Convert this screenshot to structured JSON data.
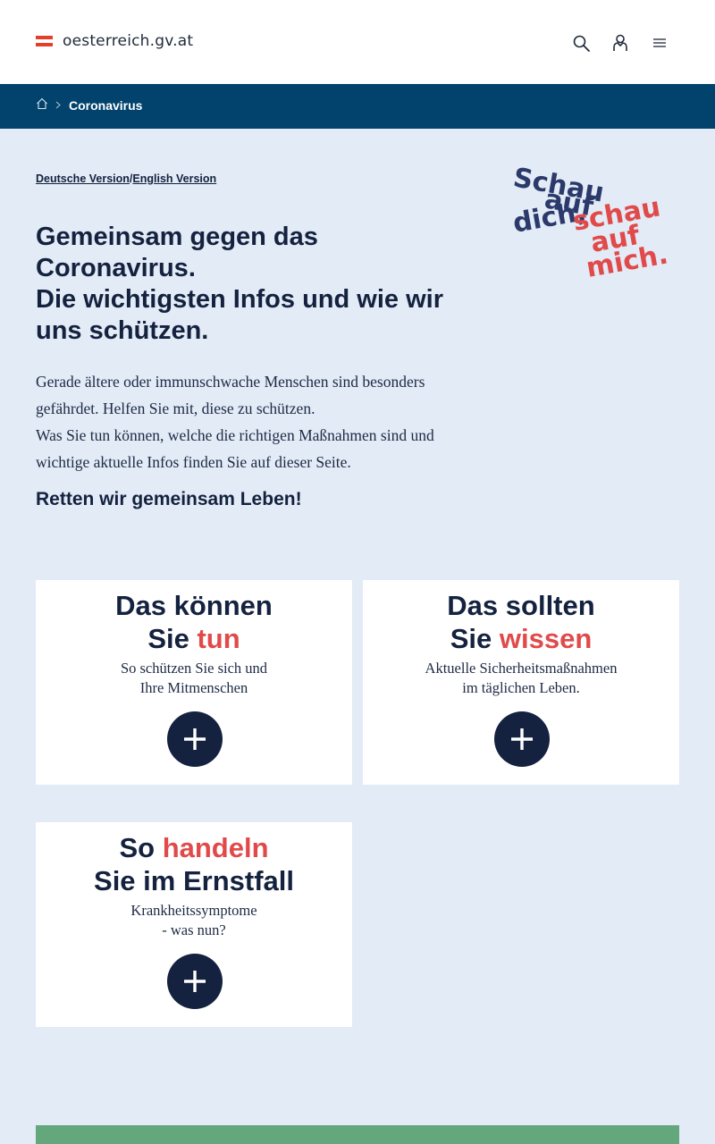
{
  "header": {
    "site_name": "oesterreich.gv.at",
    "icons": [
      "search-icon",
      "user-icon",
      "menu-icon"
    ],
    "flag_colors": [
      "#e3402b",
      "#ffffff",
      "#e3402b"
    ]
  },
  "breadcrumb": {
    "home_icon": "home-icon",
    "current": "Coronavirus"
  },
  "language": {
    "german": "Deutsche Version",
    "separator": "/",
    "english": "English Version"
  },
  "slogan": {
    "line1": "Schau",
    "line2": "auf",
    "line3": "dich,",
    "line4": "schau",
    "line5": "auf",
    "line6": "mich."
  },
  "hero": {
    "title_lines": [
      "Gemeinsam gegen das",
      "Coronavirus.",
      "Die wichtigsten Infos und wie wir",
      "uns schützen."
    ],
    "intro_1": "Gerade ältere oder immunschwache Menschen sind besonders gefährdet. Helfen Sie mit, diese zu schützen.",
    "intro_2": "Was Sie tun können, welche die richtigen Maßnahmen sind und wichtige aktuelle Infos finden Sie auf dieser Seite.",
    "cta": "Retten wir gemeinsam Leben!"
  },
  "cards": [
    {
      "line1": "Das können",
      "line2_pre": "Sie ",
      "line2_hl": "tun",
      "desc1": "So schützen Sie sich und",
      "desc2": "Ihre Mitmenschen"
    },
    {
      "line1": "Das sollten",
      "line2_pre": "Sie ",
      "line2_hl": "wissen",
      "desc1": "Aktuelle Sicherheitsmaßnahmen",
      "desc2": "im täglichen Leben."
    },
    {
      "line1_pre": "So ",
      "line1_hl": "handeln",
      "line2": "Sie im Ernstfall",
      "desc1": "Krankheitssymptome",
      "desc2": "- was nun?"
    }
  ],
  "colors": {
    "navy": "#14223f",
    "breadcrumb_bg": "#02436e",
    "highlight_red": "#e14a4a",
    "page_bg": "#e2ebf6",
    "green_bar": "#65a77c"
  }
}
